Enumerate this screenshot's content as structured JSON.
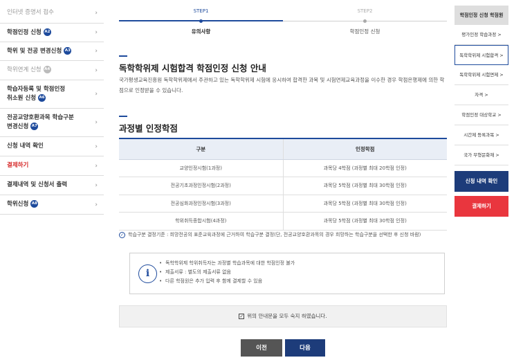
{
  "sidebar": {
    "items": [
      {
        "label": "인터넷 증명서 접수",
        "badge": "",
        "style": "muted"
      },
      {
        "label": "학점인정 신청",
        "badge": "A2",
        "style": "bold"
      },
      {
        "label": "학위 및 전공 변경신청",
        "badge": "A3",
        "style": "bold"
      },
      {
        "label": "학위연계 신청",
        "badge": "A4",
        "style": "muted"
      },
      {
        "label": "학습자등록 및 학점인정",
        "label2": "취소원 신청",
        "badge": "A6",
        "style": "bold"
      },
      {
        "label": "전공교양호환과목 학습구분",
        "label2": "변경신청",
        "badge": "A7",
        "style": "bold"
      },
      {
        "label": "신청 내역 확인",
        "badge": "",
        "style": "bold"
      },
      {
        "label": "결제하기",
        "badge": "",
        "style": "red"
      },
      {
        "label": "결제내역 및 신청서 출력",
        "badge": "",
        "style": "bold"
      },
      {
        "label": "학위신청",
        "badge": "A8",
        "style": "bold"
      }
    ],
    "chevron": "›"
  },
  "steps": [
    {
      "num": "STEP1",
      "name": "유의사항",
      "active": true
    },
    {
      "num": "STEP2",
      "name": "학점인정 신청",
      "active": false
    }
  ],
  "section1": {
    "title": "독학학위제 시험합격 학점인정 신청 안내",
    "desc": "국가평생교육진흥원 독학학위제에서 주관하고 있는 독학학위제 시험에 응시하여 합격한 과목 및 시험면제교육과정을 이수한 경우 학점은행제에 의한 학점으로 인정받을 수 있습니다."
  },
  "section2": {
    "title": "과정별 인정학점",
    "headers": [
      "구분",
      "인정학점"
    ],
    "rows": [
      [
        "교양인정시험(1과정)",
        "과목당 4학점 (과정별 최대 20학점 인정)"
      ],
      [
        "전공기초과정인정시험(2과정)",
        "과목당 5학점 (과정별 최대 30학점 인정)"
      ],
      [
        "전공심화과정인정시험(3과정)",
        "과목당 5학점 (과정별 최대 30학점 인정)"
      ],
      [
        "학위취득종합시험(4과정)",
        "과목당 5학점 (과정별 최대 30학점 인정)"
      ]
    ]
  },
  "note": "학습구분 결정기준 : 희망전공의 표준교육과정에 근거하여 학습구분 결정(단, 전공교양호환과목의 경우 희망하는 학습구분을 선택한 후 신청 바람)",
  "info": {
    "icon": "i",
    "items": [
      "독학학위제 학위취득자는 과정별 학습과목에 대한 학점인정 불가",
      "제출서류 : 별도의 제출서류 없음",
      "다른 학점원은 추가 입력 후 함께 결제할 수 있음"
    ]
  },
  "agree": {
    "checked": "✓",
    "label": "위의 안내문을 모두 숙지 하였습니다."
  },
  "buttons": {
    "prev": "이전",
    "next": "다음"
  },
  "quick": {
    "title": "학점인정 신청 학점원",
    "items": [
      "평가인정 학습과정 >",
      "독학학위제 시험합격 >",
      "독학학위제 시험면제 >",
      "자격 >",
      "학점인정 대상학교 >",
      "시간제 등록과목 >",
      "국가 무형문화재 >"
    ],
    "active_index": 1,
    "confirm": "신청 내역 확인",
    "pay": "결제하기"
  },
  "colors": {
    "accent": "#1d4a9c",
    "navy_button": "#1d3c7a",
    "red": "#e9363e"
  }
}
